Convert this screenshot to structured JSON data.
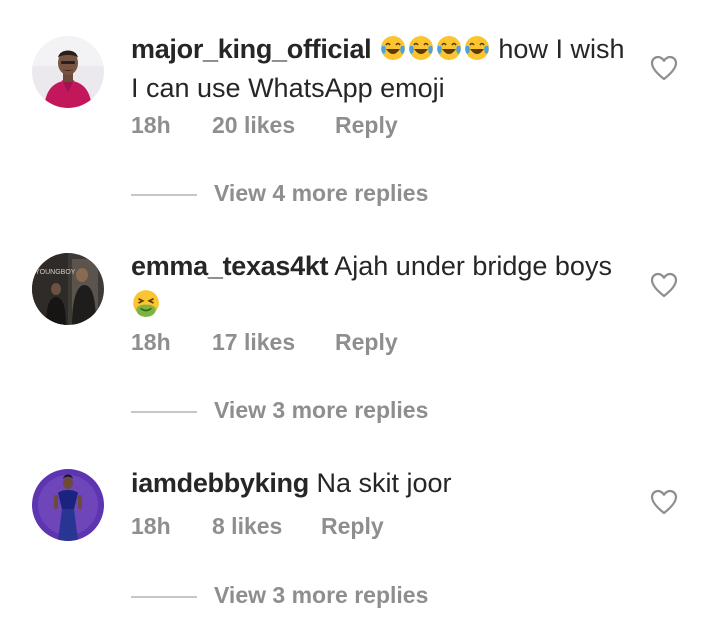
{
  "comments": [
    {
      "username": "major_king_official",
      "emojis": [
        "face-with-tears-of-joy",
        "face-with-tears-of-joy",
        "face-with-tears-of-joy",
        "face-with-tears-of-joy"
      ],
      "text": "how I wish I can use WhatsApp emoji",
      "time": "18h",
      "likes": "20 likes",
      "reply_label": "Reply",
      "view_replies": "View 4 more replies",
      "avatar_icon": "man-in-pink-shirt-avatar",
      "liked": false
    },
    {
      "username": "emma_texas4kt",
      "text": "Ajah under bridge boys",
      "emojis": [
        "nauseated-face"
      ],
      "time": "18h",
      "likes": "17 likes",
      "reply_label": "Reply",
      "view_replies": "View 3 more replies",
      "avatar_icon": "movie-poster-avatar",
      "avatar_text": "YOUNGBOY",
      "liked": false
    },
    {
      "username": "iamdebbyking",
      "text": "Na skit joor",
      "time": "18h",
      "likes": "8 likes",
      "reply_label": "Reply",
      "view_replies": "View 3 more replies",
      "avatar_icon": "woman-in-blue-dress-avatar",
      "liked": false
    }
  ],
  "colors": {
    "text": "#262626",
    "secondary": "#8e8e8e",
    "divider": "#c7c7c7"
  }
}
